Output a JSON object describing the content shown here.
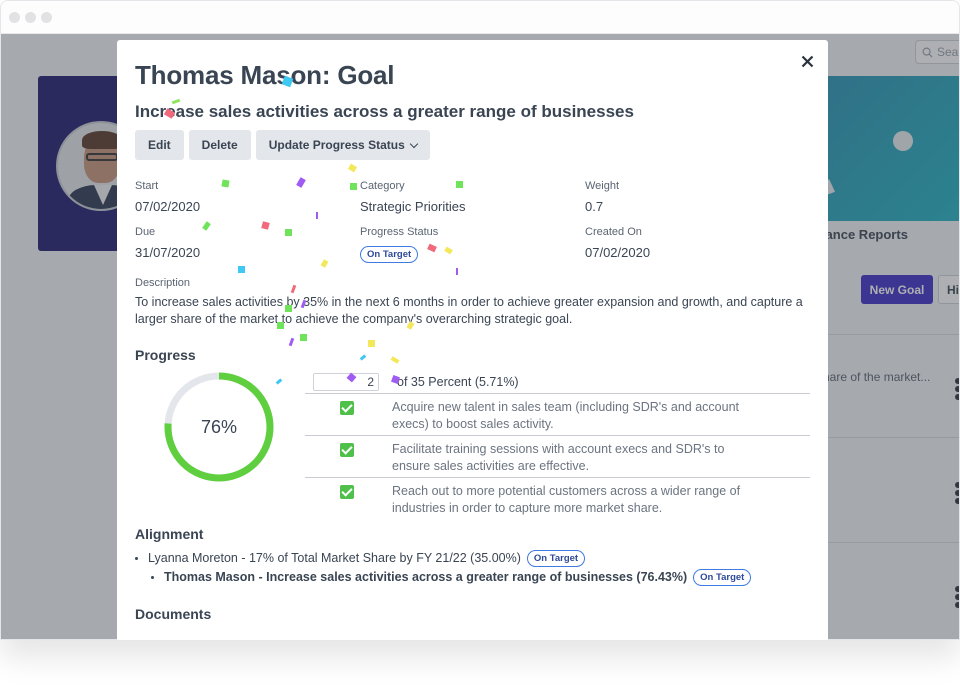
{
  "browser": {
    "window_dots": [
      "close",
      "minimize",
      "maximize"
    ]
  },
  "background_app": {
    "search_placeholder": "Sea",
    "banner_caption": "ormance Reports",
    "new_goal_label": "New Goal",
    "history_label": "Hi",
    "row_snippet": "hare of the market..."
  },
  "modal": {
    "title": "Thomas Mason: Goal",
    "subtitle": "Increase sales activities across a greater range of businesses",
    "buttons": {
      "edit": "Edit",
      "delete": "Delete",
      "update_status": "Update Progress Status"
    },
    "meta": {
      "start_label": "Start",
      "start_value": "07/02/2020",
      "category_label": "Category",
      "category_value": "Strategic Priorities",
      "weight_label": "Weight",
      "weight_value": "0.7",
      "due_label": "Due",
      "due_value": "31/07/2020",
      "status_label": "Progress Status",
      "status_value": "On Target",
      "created_label": "Created On",
      "created_value": "07/02/2020"
    },
    "description": {
      "label": "Description",
      "text": "To increase sales activities by 35% in the next 6 months in order to achieve greater expansion and growth, and capture a larger share of the market to achieve the company's overarching strategic goal."
    },
    "progress": {
      "title": "Progress",
      "percent": 76,
      "percent_label": "76%",
      "input_value": "2",
      "of_text": "of 35 Percent (5.71%)",
      "tasks": [
        {
          "text": "Acquire new talent in sales team (including SDR's and account execs) to boost sales activity.",
          "done": true
        },
        {
          "text": "Facilitate training sessions with account execs and SDR's to ensure sales activities are effective.",
          "done": true
        },
        {
          "text": "Reach out to more potential customers across a wider range of industries in order to capture more market share.",
          "done": true
        }
      ]
    },
    "alignment": {
      "title": "Alignment",
      "items": [
        {
          "text": "Lyanna Moreton - 17% of Total Market Share by FY 21/22 (35.00%)",
          "status": "On Target"
        },
        {
          "text": "Thomas Mason - Increase sales activities across a greater range of businesses (76.43%)",
          "status": "On Target"
        }
      ]
    },
    "documents": {
      "title": "Documents"
    }
  },
  "colors": {
    "progress_green": "#5fcf3f",
    "progress_track": "#e3e6ea",
    "badge_blue": "#3f7be3",
    "primary_button": "#3d2fc9",
    "text": "#3a4553"
  }
}
